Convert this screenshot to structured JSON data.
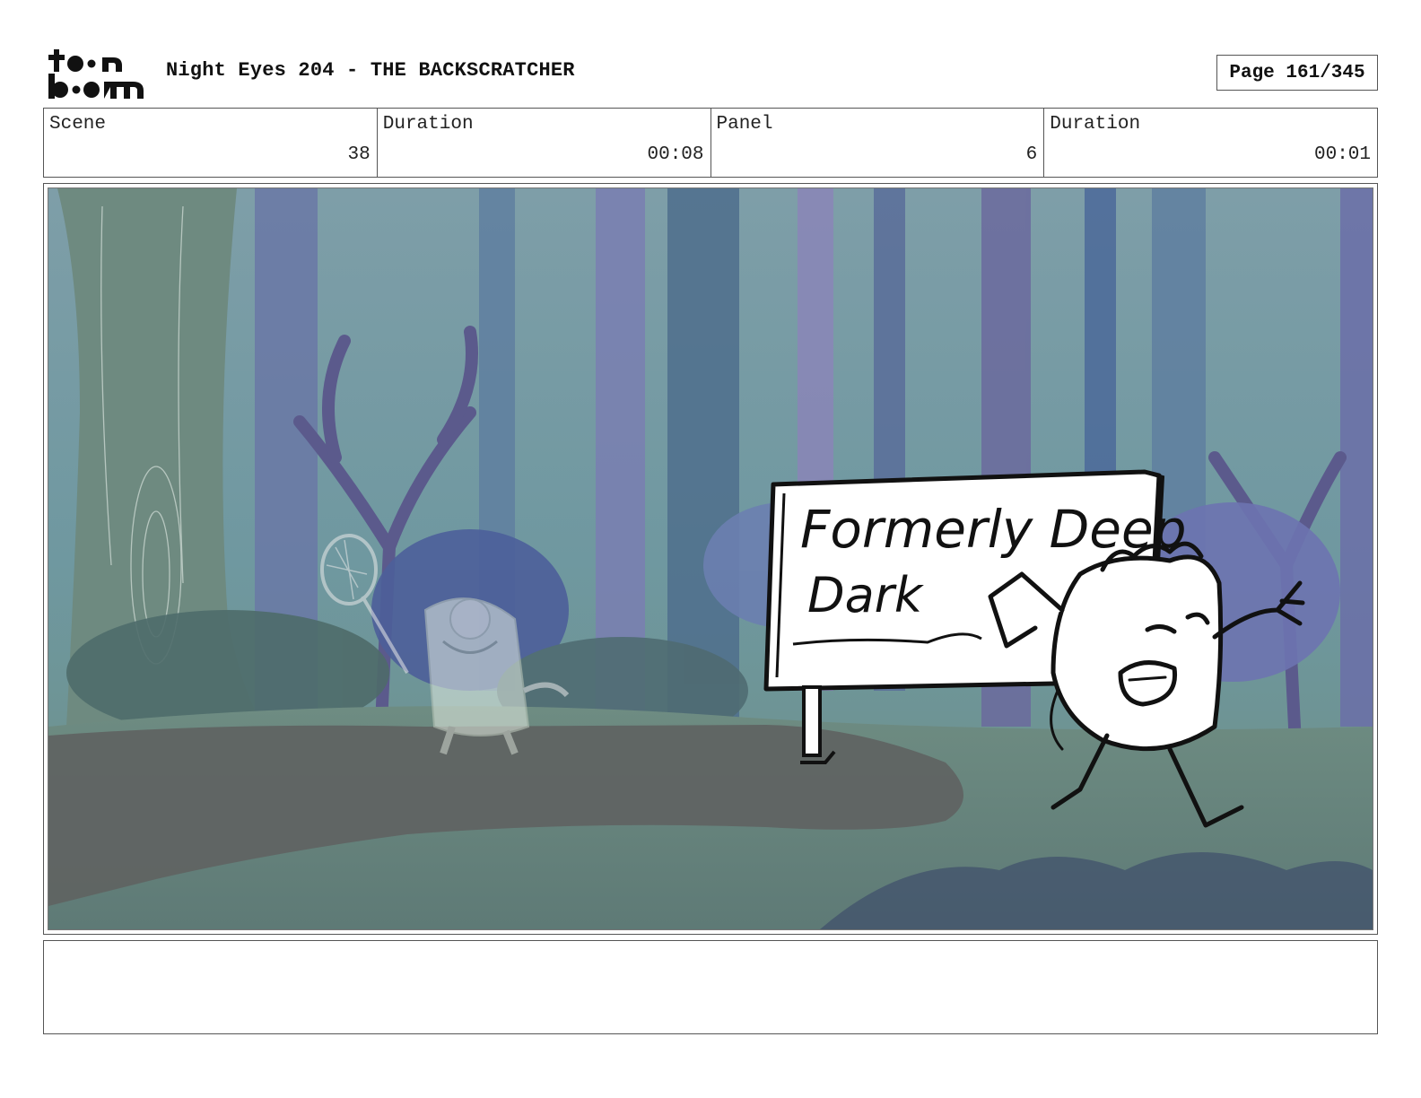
{
  "header": {
    "logo_text": "toon boom",
    "title": "Night Eyes 204 - THE BACKSCRATCHER",
    "page_label": "Page 161/345"
  },
  "info": {
    "scene_label": "Scene",
    "scene_value": "38",
    "scene_duration_label": "Duration",
    "scene_duration_value": "00:08",
    "panel_label": "Panel",
    "panel_value": "6",
    "panel_duration_label": "Duration",
    "panel_duration_value": "00:01"
  },
  "panel": {
    "sign_line1": "Formerly Deep",
    "sign_line2": "Dark"
  },
  "notes": {
    "text": ""
  }
}
